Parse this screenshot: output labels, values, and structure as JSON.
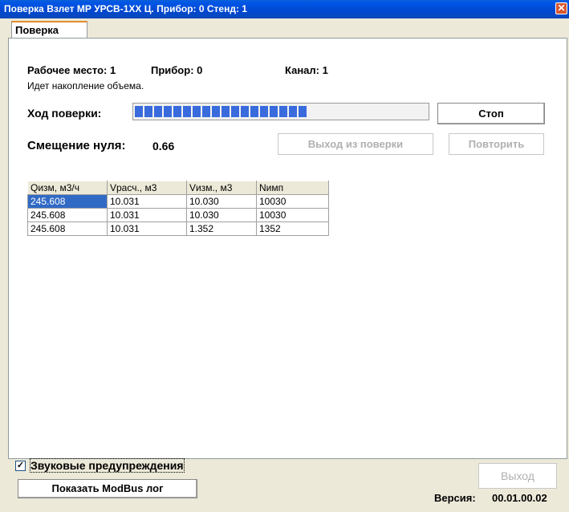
{
  "window": {
    "title": "Поверка Взлет МР УРСВ-1ХХ Ц. Прибор: 0 Стенд: 1",
    "close_label": "✕"
  },
  "tab": {
    "label": "Поверка"
  },
  "info": {
    "workplace": "Рабочее место: 1",
    "device": "Прибор: 0",
    "channel": "Канал: 1",
    "status": "Идет накопление объема."
  },
  "progress": {
    "label": "Ход поверки:",
    "value": 0.61
  },
  "zero": {
    "label": "Смещение нуля:",
    "value": "0.66"
  },
  "buttons": {
    "stop": "Стоп",
    "exit_verification": "Выход из поверки",
    "repeat": "Повторить",
    "exit": "Выход",
    "modbus": "Показать ModBus лог"
  },
  "table": {
    "headers": [
      "Qизм, м3/ч",
      "Vрасч., м3",
      "Vизм., м3",
      "Nимп"
    ],
    "rows": [
      [
        "245.608",
        "10.031",
        "10.030",
        "10030"
      ],
      [
        "245.608",
        "10.031",
        "10.030",
        "10030"
      ],
      [
        "245.608",
        "10.031",
        "1.352",
        "1352"
      ]
    ]
  },
  "sound": {
    "label": "Звуковые предупреждения",
    "checked": true,
    "check_glyph": "✓"
  },
  "version": {
    "label": "Версия:",
    "value": "00.01.00.02"
  }
}
